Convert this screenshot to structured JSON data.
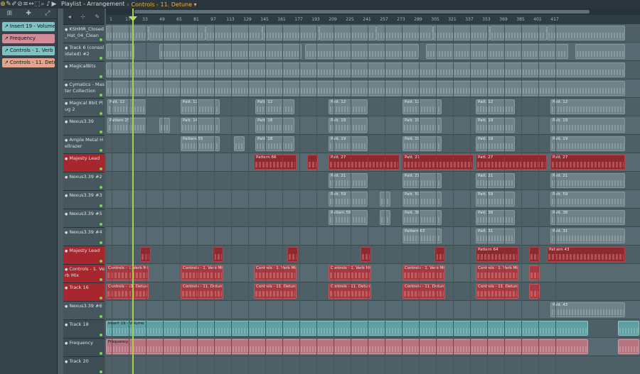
{
  "toolbar": {
    "title": "Playlist - Arrangement",
    "separator": "›",
    "crumb": "Controls - 11. Detune ▾",
    "icons": [
      "magnet-icon",
      "pencil-icon",
      "brush-icon",
      "delete-icon",
      "mute-icon",
      "slip-icon",
      "select-icon",
      "zoom-icon",
      "speaker-icon",
      "play-icon"
    ]
  },
  "left_panel": {
    "clips": [
      {
        "label": "Insert 19 - Volume",
        "color": "teal"
      },
      {
        "label": "Frequency",
        "color": "pink"
      },
      {
        "label": "Controls - 1. Verb Mix",
        "color": "teal"
      },
      {
        "label": "Controls - 11. Detune",
        "color": "peach"
      }
    ]
  },
  "ruler": {
    "numbers": [
      "1",
      "17",
      "33",
      "49",
      "65",
      "81",
      "97",
      "113",
      "129",
      "145",
      "161",
      "177",
      "193",
      "209",
      "225",
      "241",
      "257",
      "273",
      "289",
      "305",
      "321",
      "337",
      "353",
      "369",
      "385",
      "401",
      "417"
    ]
  },
  "tracks": [
    {
      "name": "KSHMR_Closed_Hat_04_Clean",
      "style": "gray"
    },
    {
      "name": "Track 6 (consolidated) #2",
      "style": "gray"
    },
    {
      "name": "MagicalBits",
      "style": "gray"
    },
    {
      "name": "Cymatics - Master Collection",
      "style": "gray"
    },
    {
      "name": "Magical 8bit Plug 2",
      "style": "gray"
    },
    {
      "name": "Nexus3.39",
      "style": "gray"
    },
    {
      "name": "Ample Metal Hellrazer",
      "style": "gray"
    },
    {
      "name": "Majesty Lead",
      "style": "red"
    },
    {
      "name": "Nexus3.39 #2",
      "style": "gray"
    },
    {
      "name": "Nexus3.39 #3",
      "style": "gray"
    },
    {
      "name": "Nexus3.39 #5",
      "style": "gray"
    },
    {
      "name": "Nexus3.39 #4",
      "style": "gray"
    },
    {
      "name": "Majesty Lead",
      "style": "red"
    },
    {
      "name": "Controls - 1. Verb Mix",
      "style": "red"
    },
    {
      "name": "Track 16",
      "style": "red"
    },
    {
      "name": "Nexus3.39 #6",
      "style": "gray"
    },
    {
      "name": "Track 18",
      "style": "dim"
    },
    {
      "name": "Frequency",
      "style": "dim"
    },
    {
      "name": "Track 20",
      "style": "dim"
    },
    {
      "name": "Track 21",
      "style": "dim"
    }
  ],
  "clip_labels": {
    "patt12": "Patt. 12",
    "pattern25": "Pattern 25",
    "patt14": "Patt. 14",
    "pattern55": "Pattern 55",
    "patt18": "Patt. 18",
    "patt19": "Patt. 19",
    "pattern66": "Pattern 66",
    "patt27": "Patt. 27",
    "patt21": "Patt. 21",
    "patt59": "Patt. 59",
    "pattern58": "Pattern 58",
    "patt38": "Patt. 38",
    "pattern63": "Pattern 63",
    "patt31": "Patt. 31",
    "pattern64": "Pattern 64",
    "pattern43": "Pattern 43",
    "verb_mix": "Controls - 1. Verb Mix",
    "detune": "Controls - 11. Detune",
    "patt43": "Patt. 43",
    "insert19": "Insert 19 - Volume",
    "frequency": "Frequency"
  }
}
